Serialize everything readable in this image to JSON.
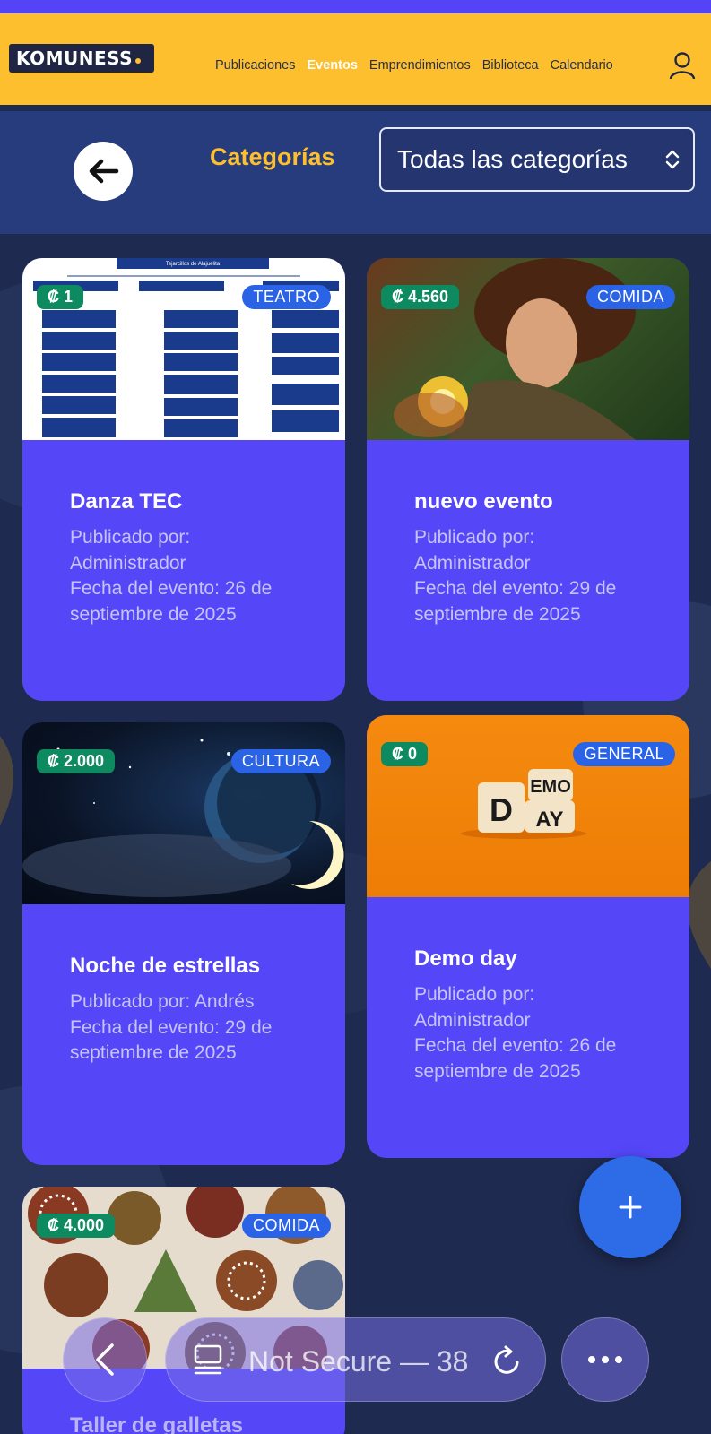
{
  "brand": {
    "logo_text": "KOMUNESS"
  },
  "nav": {
    "links": [
      {
        "label": "Publicaciones",
        "active": false
      },
      {
        "label": "Eventos",
        "active": true
      },
      {
        "label": "Emprendimientos",
        "active": false
      },
      {
        "label": "Biblioteca",
        "active": false
      },
      {
        "label": "Calendario",
        "active": false
      }
    ],
    "user_icon": "user-icon"
  },
  "filter": {
    "label": "Categorías",
    "selected": "Todas las categorías"
  },
  "events": [
    {
      "title": "Danza TEC",
      "price": "₡ 1",
      "category": "TEATRO",
      "published_by": "Publicado por: Administrador",
      "date": "Fecha del evento: 26 de septiembre de 2025",
      "image": "diagram-screenshot",
      "image_heading": "Tejarcillos de Alajuelita"
    },
    {
      "title": "nuevo evento",
      "price": "₡ 4.560",
      "category": "COMIDA",
      "published_by": "Publicado por: Administrador",
      "date": "Fecha del evento: 29 de septiembre de 2025",
      "image": "anime-character"
    },
    {
      "title": "Noche de estrellas",
      "price": "₡ 2.000",
      "category": "CULTURA",
      "published_by": "Publicado por: Andrés",
      "date": "Fecha del evento: 29 de septiembre de 2025",
      "image": "night-sky-planet"
    },
    {
      "title": "Demo day",
      "price": "₡ 0",
      "category": "GENERAL",
      "published_by": "Publicado por: Administrador",
      "date": "Fecha del evento: 26 de septiembre de 2025",
      "image": "demo-day-blocks",
      "image_letters": {
        "top": "EMO",
        "left": "D",
        "bottom": "AY"
      }
    },
    {
      "title": "Taller de galletas",
      "price": "₡ 4.000",
      "category": "COMIDA",
      "image": "cookies"
    }
  ],
  "fab": {
    "label": "+"
  },
  "browser": {
    "address": "Not Secure — 38",
    "back_icon": "chevron-left-icon",
    "tabs_icon": "tabs-icon",
    "reload_icon": "reload-icon",
    "more_icon": "more-icon"
  },
  "colors": {
    "brand_yellow": "#fdbf2d",
    "card_purple": "#5547f8",
    "header_blue": "#273c7c",
    "price_green": "#0d8a5f",
    "tag_blue": "#2b63e7"
  }
}
